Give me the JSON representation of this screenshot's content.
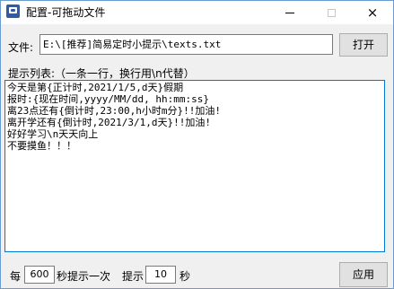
{
  "window": {
    "title": "配置-可拖动文件",
    "icon": "app-icon"
  },
  "titlebar_buttons": {
    "minimize": "minimize-icon",
    "maximize": "maximize-icon",
    "close": "×"
  },
  "file": {
    "label": "文件:",
    "path": "E:\\[推荐]简易定时小提示\\texts.txt",
    "open_button": "打开"
  },
  "list": {
    "label": "提示列表:（一条一行，换行用\\n代替）",
    "lines": [
      "今天是第{正计时,2021/1/5,d天}假期",
      "报时:{现在时间,yyyy/MM/dd, hh:mm:ss}",
      "离23点还有{倒计时,23:00,h小时m分}!!加油!",
      "离开学还有{倒计时,2021/3/1,d天}!!加油!",
      "好好学习\\n天天向上",
      "不要摸鱼！！！"
    ]
  },
  "footer": {
    "every_prefix": "每",
    "every_value": "600",
    "every_suffix": "秒提示一次",
    "tip_label": "提示",
    "tip_value": "10",
    "tip_suffix": "秒",
    "apply_button": "应用"
  }
}
